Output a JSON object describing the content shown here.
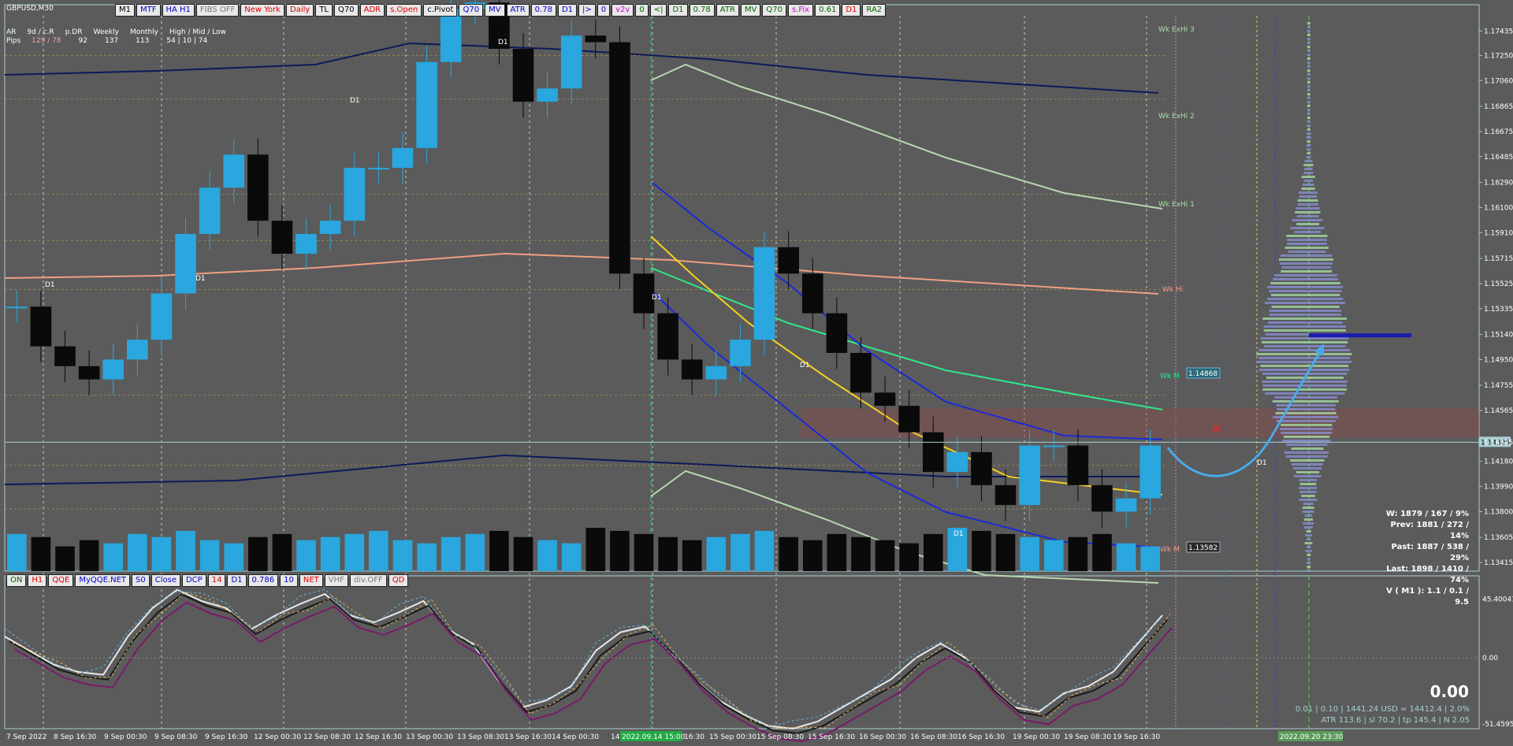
{
  "symbol": "GBPUSD,M30",
  "colors": {
    "bg": "#5b5b5b",
    "bull": "#29a7de",
    "bear": "#0a0a0a",
    "axis": "#a8cfd4",
    "buttonBg": "#e8e8e8"
  },
  "toolbar_top": [
    {
      "label": "M1",
      "color": "#000"
    },
    {
      "label": "MTF",
      "color": "#0000cc"
    },
    {
      "label": "HA H1",
      "color": "#0000cc"
    },
    {
      "label": "FIBS OFF",
      "color": "#777"
    },
    {
      "label": "New York",
      "color": "#e00000"
    },
    {
      "label": "Daily",
      "color": "#e00000"
    },
    {
      "label": "TL",
      "color": "#000"
    },
    {
      "label": "Q70",
      "color": "#000"
    },
    {
      "label": "ADR",
      "color": "#e00000"
    },
    {
      "label": "s.Open",
      "color": "#e00000"
    },
    {
      "label": "c.Pivot",
      "color": "#000"
    },
    {
      "label": "Q70",
      "color": "#0000cc"
    },
    {
      "label": "MV",
      "color": "#0000cc"
    },
    {
      "label": "ATR",
      "color": "#0000cc"
    },
    {
      "label": "0.78",
      "color": "#0000cc"
    },
    {
      "label": "D1",
      "color": "#0000cc"
    },
    {
      "label": "|>",
      "color": "#0000cc"
    },
    {
      "label": "0",
      "color": "#0000cc"
    },
    {
      "label": "v2v",
      "color": "#cc00cc"
    },
    {
      "label": "0",
      "color": "#006600"
    },
    {
      "label": "<|",
      "color": "#006600"
    },
    {
      "label": "D1",
      "color": "#006600"
    },
    {
      "label": "0.78",
      "color": "#006600"
    },
    {
      "label": "ATR",
      "color": "#006600"
    },
    {
      "label": "MV",
      "color": "#006600"
    },
    {
      "label": "Q70",
      "color": "#006600"
    },
    {
      "label": "s.Fix",
      "color": "#cc00cc"
    },
    {
      "label": "0.61",
      "color": "#006600"
    },
    {
      "label": "D1",
      "color": "#e00000"
    },
    {
      "label": "RA2",
      "color": "#006600"
    }
  ],
  "toolbar_bottom": [
    {
      "label": "ON",
      "color": "#006600"
    },
    {
      "label": "H1",
      "color": "#e00000"
    },
    {
      "label": "QQE",
      "color": "#e00000"
    },
    {
      "label": "MyQQE.NET",
      "color": "#0000cc"
    },
    {
      "label": "S0",
      "color": "#0000cc"
    },
    {
      "label": "Close",
      "color": "#0000cc"
    },
    {
      "label": "DCP",
      "color": "#0000cc"
    },
    {
      "label": "14",
      "color": "#e00000"
    },
    {
      "label": "D1",
      "color": "#0000cc"
    },
    {
      "label": "0.786",
      "color": "#0000cc"
    },
    {
      "label": "10",
      "color": "#0000cc"
    },
    {
      "label": "NET",
      "color": "#e00000"
    },
    {
      "label": "VHF",
      "color": "#777"
    },
    {
      "label": "div.OFF",
      "color": "#777"
    },
    {
      "label": "QD",
      "color": "#e00000"
    }
  ],
  "adr_table": {
    "headers": [
      "AR",
      "9d / c.R",
      "p.DR",
      "Weekly",
      "Monthly",
      "High / Mid / Low"
    ],
    "row_label": "Pips",
    "values": [
      "129 / 78",
      "92",
      "137",
      "113",
      "54 | 10 | 74"
    ]
  },
  "price_axis": [
    "1.17435",
    "1.17250",
    "1.17060",
    "1.16865",
    "1.16675",
    "1.16485",
    "1.16290",
    "1.16100",
    "1.15910",
    "1.15715",
    "1.15525",
    "1.15335",
    "1.15140",
    "1.14950",
    "1.14755",
    "1.14565",
    "1.14325",
    "1.14180",
    "1.13990",
    "1.13800",
    "1.13605",
    "1.13415"
  ],
  "current_price": "1.14325",
  "osc_axis": [
    "45.40041",
    "0.00",
    "-51.45957"
  ],
  "time_axis": [
    "7 Sep 2022",
    "8 Sep 16:30",
    "9 Sep 00:30",
    "9 Sep 08:30",
    "9 Sep 16:30",
    "12 Sep 00:30",
    "12 Sep 08:30",
    "12 Sep 16:30",
    "13 Sep 00:30",
    "13 Sep 08:30",
    "13 Sep 16:30",
    "14 Sep 00:30",
    "14",
    "15 Sep 00:30",
    "15 Sep 08:30",
    "15 Sep 16:30",
    "16 Sep 00:30",
    "16 Sep 08:30",
    "16 Sep 16:30",
    "19 Sep 00:30",
    "19 Sep 08:30",
    "19 Sep 16:30"
  ],
  "time_highlight": "2022.09.14 15:00",
  "time_after_highlight": "16:30",
  "time_right_highlight": "2022.09.20 23:30",
  "chart_labels": {
    "wk_exhi3": "Wk ExHi 3",
    "wk_exhi2": "Wk ExHi 2",
    "wk_exhi1": "Wk ExHi 1",
    "wk_hi": "Wk Hi",
    "wk_mid": "Wk M",
    "wk_mid_value": "1.14868",
    "wk_low": "Wk M",
    "wk_low_value": "1.13582",
    "d1": "D1"
  },
  "stats": [
    "W: 1879 / 167 / 9%",
    "Prev: 1881 / 272 / 14%",
    "Past: 1887 / 538 / 29%",
    "Last: 1898 / 1410 / 74%",
    "V ( M1 ): 1.1 / 0.1 / 9.5"
  ],
  "big_value": "0.00",
  "bottom_info": [
    "0.01  |  0.10  |  1441.24 USD = 14412.4  |  2.0%",
    "ATR 113.6  | sl 70.2  |  tp 145.4  |  N 2.05"
  ],
  "marker_x": "✕",
  "chart_data": {
    "type": "candlestick",
    "price_closes": [
      1.1535,
      1.1505,
      1.149,
      1.148,
      1.1495,
      1.151,
      1.1545,
      1.159,
      1.1625,
      1.165,
      1.16,
      1.1575,
      1.159,
      1.16,
      1.164,
      1.164,
      1.1655,
      1.172,
      1.176,
      1.1765,
      1.173,
      1.169,
      1.17,
      1.174,
      1.1735,
      1.156,
      1.153,
      1.1495,
      1.148,
      1.149,
      1.151,
      1.158,
      1.156,
      1.153,
      1.15,
      1.147,
      1.146,
      1.144,
      1.141,
      1.1425,
      1.14,
      1.1385,
      1.143,
      1.143,
      1.14,
      1.138,
      1.139,
      1.143
    ],
    "oscillator": [
      15,
      5,
      -5,
      -10,
      -12,
      15,
      35,
      48,
      40,
      35,
      20,
      30,
      38,
      45,
      30,
      25,
      32,
      40,
      20,
      10,
      -15,
      -35,
      -30,
      -20,
      5,
      18,
      22,
      5,
      -15,
      -30,
      -40,
      -48,
      -50,
      -45,
      -35,
      -25,
      -15,
      0,
      10,
      0,
      -20,
      -35,
      -38,
      -25,
      -20,
      -10,
      10,
      30
    ],
    "volume": [
      60,
      55,
      40,
      50,
      45,
      60,
      55,
      65,
      50,
      45,
      55,
      60,
      50,
      55,
      60,
      65,
      50,
      45,
      55,
      60,
      65,
      55,
      50,
      45,
      70,
      65,
      60,
      55,
      50,
      55,
      60,
      65,
      55,
      50,
      60,
      55,
      50,
      45,
      60,
      70,
      65,
      60,
      55,
      50,
      55,
      60,
      45,
      40
    ],
    "ylim": [
      1.1335,
      1.1755
    ]
  }
}
